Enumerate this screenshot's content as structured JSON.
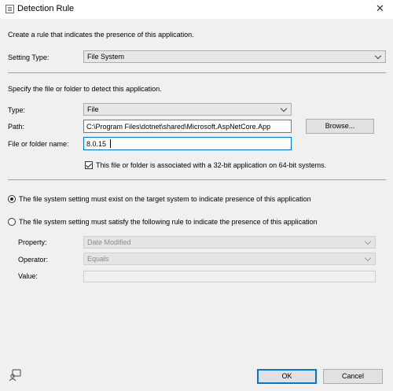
{
  "window": {
    "title": "Detection Rule",
    "close_glyph": "✕"
  },
  "intro": "Create a rule that indicates the presence of this application.",
  "setting_type": {
    "label": "Setting Type:",
    "value": "File System"
  },
  "specify_text": "Specify the file or folder to detect this application.",
  "type": {
    "label": "Type:",
    "value": "File"
  },
  "path": {
    "label": "Path:",
    "value": "C:\\Program Files\\dotnet\\shared\\Microsoft.AspNetCore.App"
  },
  "browse_label": "Browse...",
  "file_folder": {
    "label": "File or folder name:",
    "value": "8.0.15"
  },
  "checkbox_32bit": {
    "label": "This file or folder is associated with a 32-bit application on 64-bit systems.",
    "checked": true
  },
  "radio_exist": {
    "label": "The file system setting must exist on the target system to indicate presence of this application",
    "selected": true
  },
  "radio_rule": {
    "label": "The file system setting must satisfy the following rule to indicate the presence of this application",
    "selected": false
  },
  "property": {
    "label": "Property:",
    "value": "Date Modified"
  },
  "operator": {
    "label": "Operator:",
    "value": "Equals"
  },
  "value_field": {
    "label": "Value:",
    "value": ""
  },
  "buttons": {
    "ok": "OK",
    "cancel": "Cancel"
  },
  "icons": {
    "title": "window-icon",
    "help": "help-person-icon"
  },
  "colors": {
    "focus_border": "#0078d7",
    "window_bg": "#f0f0f0"
  }
}
